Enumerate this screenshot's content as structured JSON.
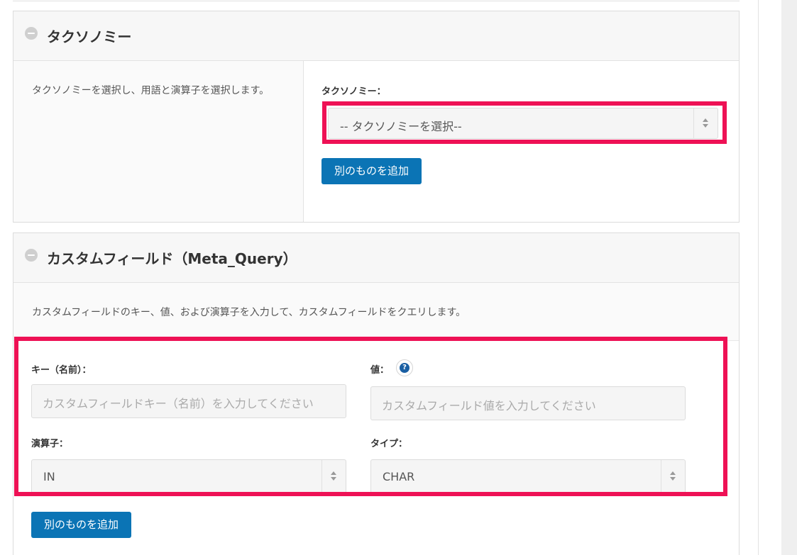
{
  "taxonomy_panel": {
    "title": "タクソノミー",
    "description": "タクソノミーを選択し、用語と演算子を選択します。",
    "field_label": "タクソノミー：",
    "select_value": "-- タクソノミーを選択--",
    "add_button": "別のものを追加"
  },
  "meta_panel": {
    "title": "カスタムフィールド（Meta_Query）",
    "description": "カスタムフィールドのキー、値、および演算子を入力して、カスタムフィールドをクエリします。",
    "key_label": "キー（名前）：",
    "key_placeholder": "カスタムフィールドキー（名前）を入力してください",
    "value_label": "値：",
    "help_glyph": "?",
    "value_placeholder": "カスタムフィールド値を入力してください",
    "operator_label": "演算子：",
    "operator_value": "IN",
    "type_label": "タイプ：",
    "type_value": "CHAR",
    "add_button": "別のものを追加"
  },
  "colors": {
    "highlight": "#ee1155",
    "button": "#0b74b5"
  },
  "icons": [
    "minus-circle-icon",
    "help-icon",
    "select-arrows-icon"
  ]
}
